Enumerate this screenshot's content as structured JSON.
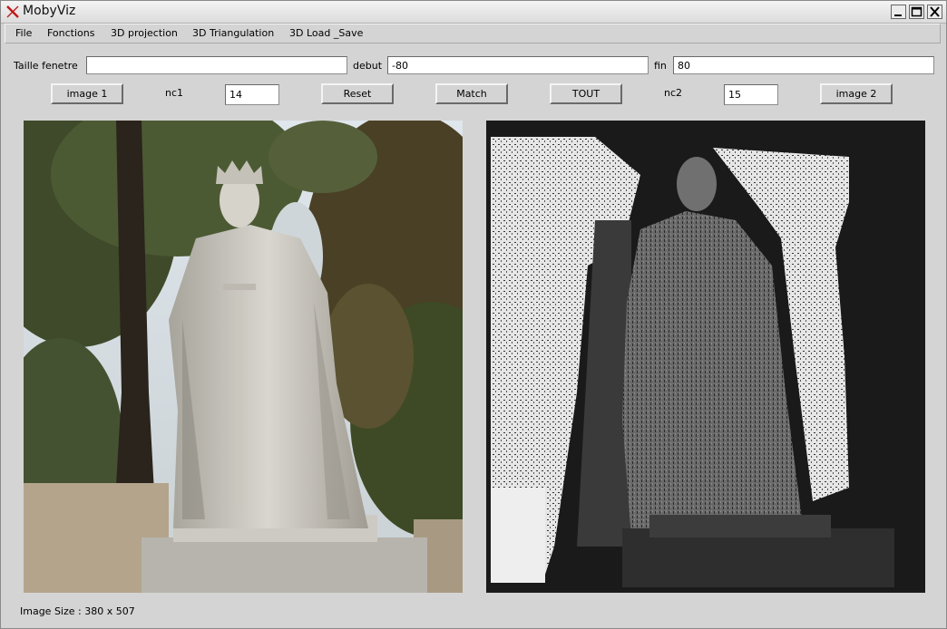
{
  "window": {
    "title": "MobyViz",
    "app_icon": "x-logo-icon",
    "controls": [
      "minimize-icon",
      "maximize-icon",
      "close-icon"
    ]
  },
  "menu": {
    "items": [
      {
        "label": "File"
      },
      {
        "label": "Fonctions"
      },
      {
        "label": "3D projection"
      },
      {
        "label": "3D Triangulation"
      },
      {
        "label": "3D Load _Save"
      }
    ]
  },
  "params": {
    "taille_label": "Taille fenetre",
    "taille_value": "",
    "debut_label": "debut",
    "debut_value": "-80",
    "fin_label": "fin",
    "fin_value": "80"
  },
  "controls": {
    "image1_label": "image 1",
    "nc1_label": "nc1",
    "nc1_value": "14",
    "reset_label": "Reset",
    "match_label": "Match",
    "tout_label": "TOUT",
    "nc2_label": "nc2",
    "nc2_value": "15",
    "image2_label": "image 2"
  },
  "images": {
    "left": "statue-photo",
    "right": "disparity-map"
  },
  "status": {
    "text": "Image Size : 380 x 507"
  },
  "colors": {
    "window_bg": "#d4d4d4",
    "disparity_bg": "#1a1a1a"
  }
}
